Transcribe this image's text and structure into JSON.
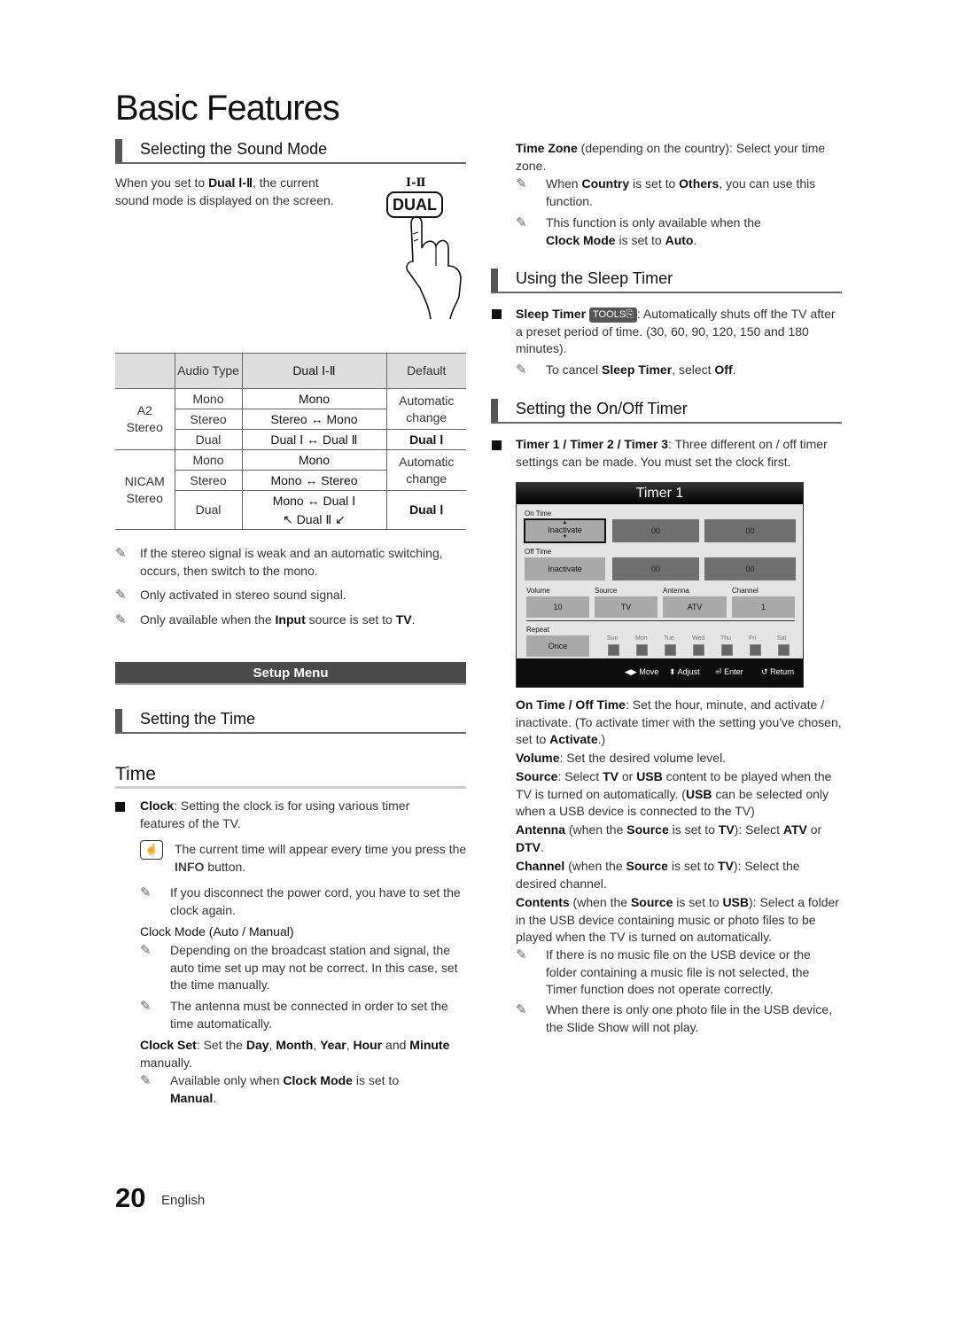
{
  "page_title": "Basic Features",
  "sound_mode": {
    "heading": "Selecting the Sound Mode",
    "intro_a": "When you set to ",
    "intro_b": "Dual Ⅰ-Ⅱ",
    "intro_c": ", the current sound mode is displayed on the screen.",
    "remote_label": "Ⅰ-Ⅱ",
    "remote_button": "DUAL",
    "table": {
      "headers": [
        "",
        "Audio Type",
        "Dual Ⅰ-Ⅱ",
        "Default"
      ],
      "groups": [
        {
          "name": "A2 Stereo",
          "rows": [
            {
              "type": "Mono",
              "dual": "Mono"
            },
            {
              "type": "Stereo",
              "dual": "Stereo ↔ Mono"
            },
            {
              "type": "Dual",
              "dual": "Dual Ⅰ ↔ Dual Ⅱ"
            }
          ],
          "default_auto": "Automatic change",
          "default_dual": "Dual Ⅰ"
        },
        {
          "name": "NICAM Stereo",
          "rows": [
            {
              "type": "Mono",
              "dual": "Mono"
            },
            {
              "type": "Stereo",
              "dual": "Mono ↔ Stereo"
            },
            {
              "type": "Dual",
              "dual": "Mono ↔ Dual Ⅰ",
              "dual2": "↖ Dual Ⅱ ↙"
            }
          ],
          "default_auto": "Automatic change",
          "default_dual": "Dual Ⅰ"
        }
      ]
    },
    "notes": [
      "If the stereo signal is weak and an automatic switching, occurs, then switch to the mono.",
      "Only activated in stereo sound signal."
    ],
    "note3_a": "Only available when the ",
    "note3_b": "Input",
    "note3_c": " source is set to ",
    "note3_d": "TV",
    "note3_e": "."
  },
  "setup_menu_label": "Setup Menu",
  "setting_time": {
    "heading": "Setting the Time",
    "subheading": "Time",
    "clock_b": "Clock",
    "clock_text": ": Setting the clock is for using various timer features of the TV.",
    "info_a": "The current time will appear every time you press the ",
    "info_b": "INFO",
    "info_c": " button.",
    "note_power": "If you disconnect the power cord, you have to set the clock again.",
    "clock_mode": "Clock Mode (Auto / Manual)",
    "note_broadcast": "Depending on the broadcast station and signal, the auto time set up may not be correct. In this case, set the time manually.",
    "note_antenna": "The antenna must be connected in order to set the time automatically.",
    "clock_set_b": "Clock Set",
    "clock_set_1": ": Set the ",
    "day": "Day",
    "month": "Month",
    "year": "Year",
    "hour": "Hour",
    "minute": "Minute",
    "clock_set_end": " manually.",
    "note_manual_a": "Available only when ",
    "note_manual_b": "Clock Mode",
    "note_manual_c": " is set to ",
    "note_manual_d": "Manual",
    "note_manual_e": "."
  },
  "time_zone": {
    "b": "Time Zone",
    "text": " (depending on the country): Select your time zone.",
    "note1_a": "When ",
    "note1_b": "Country",
    "note1_c": " is set to ",
    "note1_d": "Others",
    "note1_e": ", you can use this function.",
    "note2_a": "This function is only available when the ",
    "note2_b": "Clock Mode",
    "note2_c": " is set to ",
    "note2_d": "Auto",
    "note2_e": "."
  },
  "sleep_timer": {
    "heading": "Using the Sleep Timer",
    "b": "Sleep Timer",
    "tools": "TOOLS",
    "text": ": Automatically shuts off the TV after a preset period of time. (30, 60, 90, 120, 150 and 180 minutes).",
    "note_a": "To cancel ",
    "note_b": "Sleep Timer",
    "note_c": ", select ",
    "note_d": "Off",
    "note_e": "."
  },
  "onoff_timer": {
    "heading": "Setting the On/Off Timer",
    "b": "Timer 1 / Timer 2 / Timer 3",
    "text": ": Three different on / off timer settings can be made. You must set the clock first.",
    "osd": {
      "title": "Timer 1",
      "on_time_label": "On Time",
      "on_state": "Inactivate",
      "on_hour": "00",
      "on_min": "00",
      "off_time_label": "Off Time",
      "off_state": "Inactivate",
      "off_hour": "00",
      "off_min": "00",
      "volume_label": "Volume",
      "volume": "10",
      "source_label": "Source",
      "source": "TV",
      "antenna_label": "Antenna",
      "antenna": "ATV",
      "channel_label": "Channel",
      "channel": "1",
      "repeat_label": "Repeat",
      "repeat": "Once",
      "days": [
        "Sun",
        "Mon",
        "Tue",
        "Wed",
        "Thu",
        "Fri",
        "Sat"
      ],
      "footer": {
        "move": "Move",
        "adjust": "Adjust",
        "enter": "Enter",
        "return": "Return"
      }
    },
    "desc": {
      "onoff_b": "On Time / Off Time",
      "onoff_t": ": Set the hour, minute, and activate / inactivate. (To activate timer with the setting you've chosen, set to ",
      "onoff_b2": "Activate",
      "onoff_e": ".)",
      "vol_b": "Volume",
      "vol_t": ": Set the desired volume level.",
      "src_b": "Source",
      "src_t1": ": Select ",
      "src_tv": "TV",
      "src_or": " or ",
      "src_usb": "USB",
      "src_t2": " content to be played when the TV is turned on automatically. (",
      "src_usb2": "USB",
      "src_t3": " can be selected only when a USB device is connected to the TV)",
      "ant_b": "Antenna",
      "ant_t1": " (when the ",
      "ant_src": "Source",
      "ant_t2": " is set to ",
      "ant_tv": "TV",
      "ant_t3": "): Select ",
      "ant_atv": "ATV",
      "ant_or": " or ",
      "ant_dtv": "DTV",
      "ant_e": ".",
      "ch_b": "Channel",
      "ch_t1": " (when the ",
      "ch_src": "Source",
      "ch_t2": " is set to ",
      "ch_tv": "TV",
      "ch_t3": "): Select the desired channel.",
      "ct_b": "Contents",
      "ct_t1": " (when the ",
      "ct_src": "Source",
      "ct_t2": " is set to ",
      "ct_usb": "USB",
      "ct_t3": "): Select a folder in the USB device containing music or photo files to be played when the TV is turned on automatically.",
      "note_music": "If there is no music file on the USB device or the folder containing a music file is not selected, the Timer function does not operate correctly.",
      "note_photo": "When there is only one photo file in the USB device, the Slide Show will not play."
    }
  },
  "footer": {
    "page_number": "20",
    "language": "English"
  }
}
